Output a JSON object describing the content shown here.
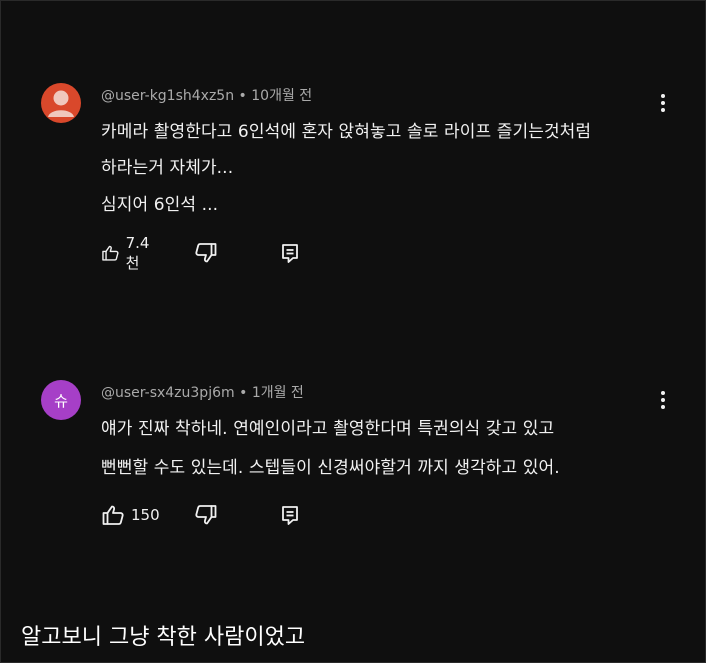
{
  "comments": [
    {
      "user": "@user-kg1sh4xz5n",
      "time": "10개월 전",
      "avatar_color": "#d9482b",
      "avatar_letter": "",
      "lines": [
        "카메라 촬영한다고 6인석에 혼자 앉혀놓고 솔로 라이프 즐기는것처럼",
        "하라는거 자체가...",
        "심지어 6인석 ..."
      ],
      "likes": "7.4천"
    },
    {
      "user": "@user-sx4zu3pj6m",
      "time": "1개월 전",
      "avatar_color": "#a63fc7",
      "avatar_letter": "슈",
      "lines": [
        "얘가 진짜 착하네. 연예인이라고 촬영한다며 특권의식 갖고 있고",
        "뻔뻔할 수도 있는데. 스텝들이 신경써야할거 까지 생각하고 있어."
      ],
      "likes": "150"
    }
  ],
  "meta_separator": "•",
  "caption": "알고보니 그냥 착한 사람이었고",
  "icons": [
    "person-avatar-icon",
    "more-vert-icon",
    "thumb-up-icon",
    "thumb-down-icon",
    "reply-icon"
  ]
}
